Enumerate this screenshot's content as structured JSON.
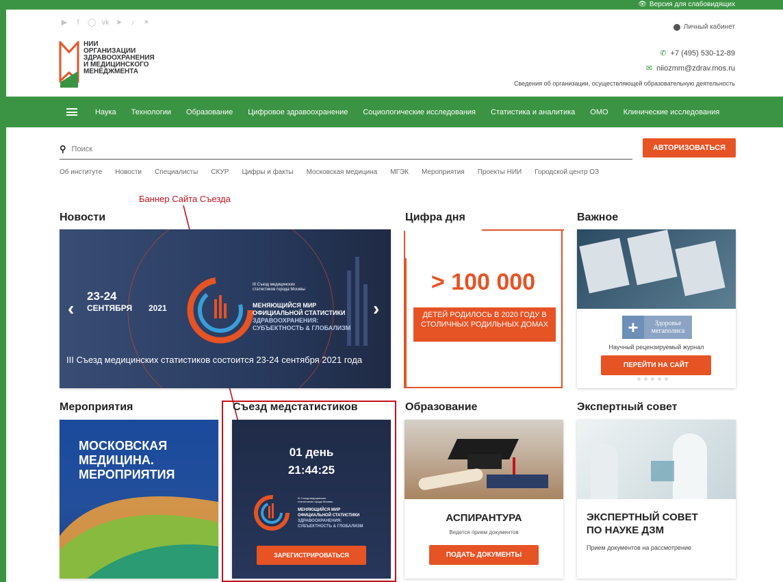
{
  "topbar": {
    "accessibility_label": "Версия для слабовидящих",
    "cabinet_label": "Личный кабинет"
  },
  "social": [
    "youtube-icon",
    "facebook-icon",
    "instagram-icon",
    "vk-icon",
    "telegram-icon",
    "tiktok-icon",
    "twitter-icon"
  ],
  "logo": {
    "line1": "НИИ",
    "line2": "организации",
    "line3": "здравоохранения",
    "line4": "и медицинского",
    "line5": "менеджмента"
  },
  "contacts": {
    "phone": "+7 (495) 530-12-89",
    "email": "niiozmm@zdrav.mos.ru",
    "org_info": "Сведения об организации, осуществляющей образовательную деятельность"
  },
  "nav": {
    "items": [
      "Наука",
      "Технологии",
      "Образование",
      "Цифровое здравоохранение",
      "Социологические исследования",
      "Статистика и аналитика",
      "ОМО",
      "Клинические исследования"
    ]
  },
  "search": {
    "placeholder": "Поиск"
  },
  "auth_button": "АВТОРИЗОВАТЬСЯ",
  "sublinks": [
    "Об институте",
    "Новости",
    "Специалисты",
    "СКУР",
    "Цифры и факты",
    "Московская медицина",
    "МГЭК",
    "Мероприятия",
    "Проекты НИИ",
    "Городской центр ОЗ"
  ],
  "annotation": {
    "label": "Баннер Сайта Съезда",
    "color": "#c2111a"
  },
  "sections": {
    "news": {
      "title": "Новости",
      "date_top": "23-24",
      "date_month": "СЕНТЯБРЯ",
      "date_year": "2021",
      "congress_sub1": "III Съезд медицинских",
      "congress_sub2": "статистиков города Москвы",
      "congress_l1": "МЕНЯЮЩИЙСЯ МИР",
      "congress_l2": "ОФИЦИАЛЬНОЙ СТАТИСТИКИ",
      "congress_l3": "ЗДРАВООХРАНЕНИЯ:",
      "congress_l4": "СУБЪЕКТНОСТЬ & ГЛОБАЛИЗМ",
      "caption": "III Съезд медицинских статистиков состоится 23-24 сентября 2021 года"
    },
    "digit": {
      "title": "Цифра дня",
      "value": "> 100 000",
      "caption": "ДЕТЕЙ РОДИЛОСЬ В 2020 ГОДУ В СТОЛИЧНЫХ РОДИЛЬНЫХ ДОМАХ"
    },
    "important": {
      "title": "Важное",
      "brand_l1": "Здоровье",
      "brand_l2": "мегаполиса",
      "desc": "Научный рецензируемый журнал",
      "button": "ПЕРЕЙТИ НА САЙТ"
    },
    "events": {
      "title": "Мероприятия",
      "l1": "МОСКОВСКАЯ",
      "l2": "МЕДИЦИНА.",
      "l3": "МЕРОПРИЯТИЯ"
    },
    "congress": {
      "title": "Съезд медстатистиков",
      "days": "01 день",
      "time": "21:44:25",
      "sub1": "III Съезд медицинских",
      "sub2": "статистиков города Москвы",
      "l1": "МЕНЯЮЩИЙСЯ МИР",
      "l2": "ОФИЦИАЛЬНОЙ СТАТИСТИКИ",
      "l3": "ЗДРАВООХРАНЕНИЯ:",
      "l4": "СУБЪЕКТНОСТЬ & ГЛОБАЛИЗМ",
      "button": "ЗАРЕГИСТРИРОВАТЬСЯ"
    },
    "education": {
      "title": "Образование",
      "heading": "АСПИРАНТУРА",
      "desc": "Ведется прием документов",
      "button": "ПОДАТЬ ДОКУМЕНТЫ"
    },
    "expert": {
      "title": "Экспертный совет",
      "heading_l1": "ЭКСПЕРТНЫЙ СОВЕТ",
      "heading_l2": "ПО НАУКЕ ДЗМ",
      "desc": "Прием документов на рассмотрение"
    }
  },
  "colors": {
    "green": "#3b9443",
    "orange": "#e65325",
    "navy": "#283a5e",
    "annotation": "#c2111a"
  }
}
